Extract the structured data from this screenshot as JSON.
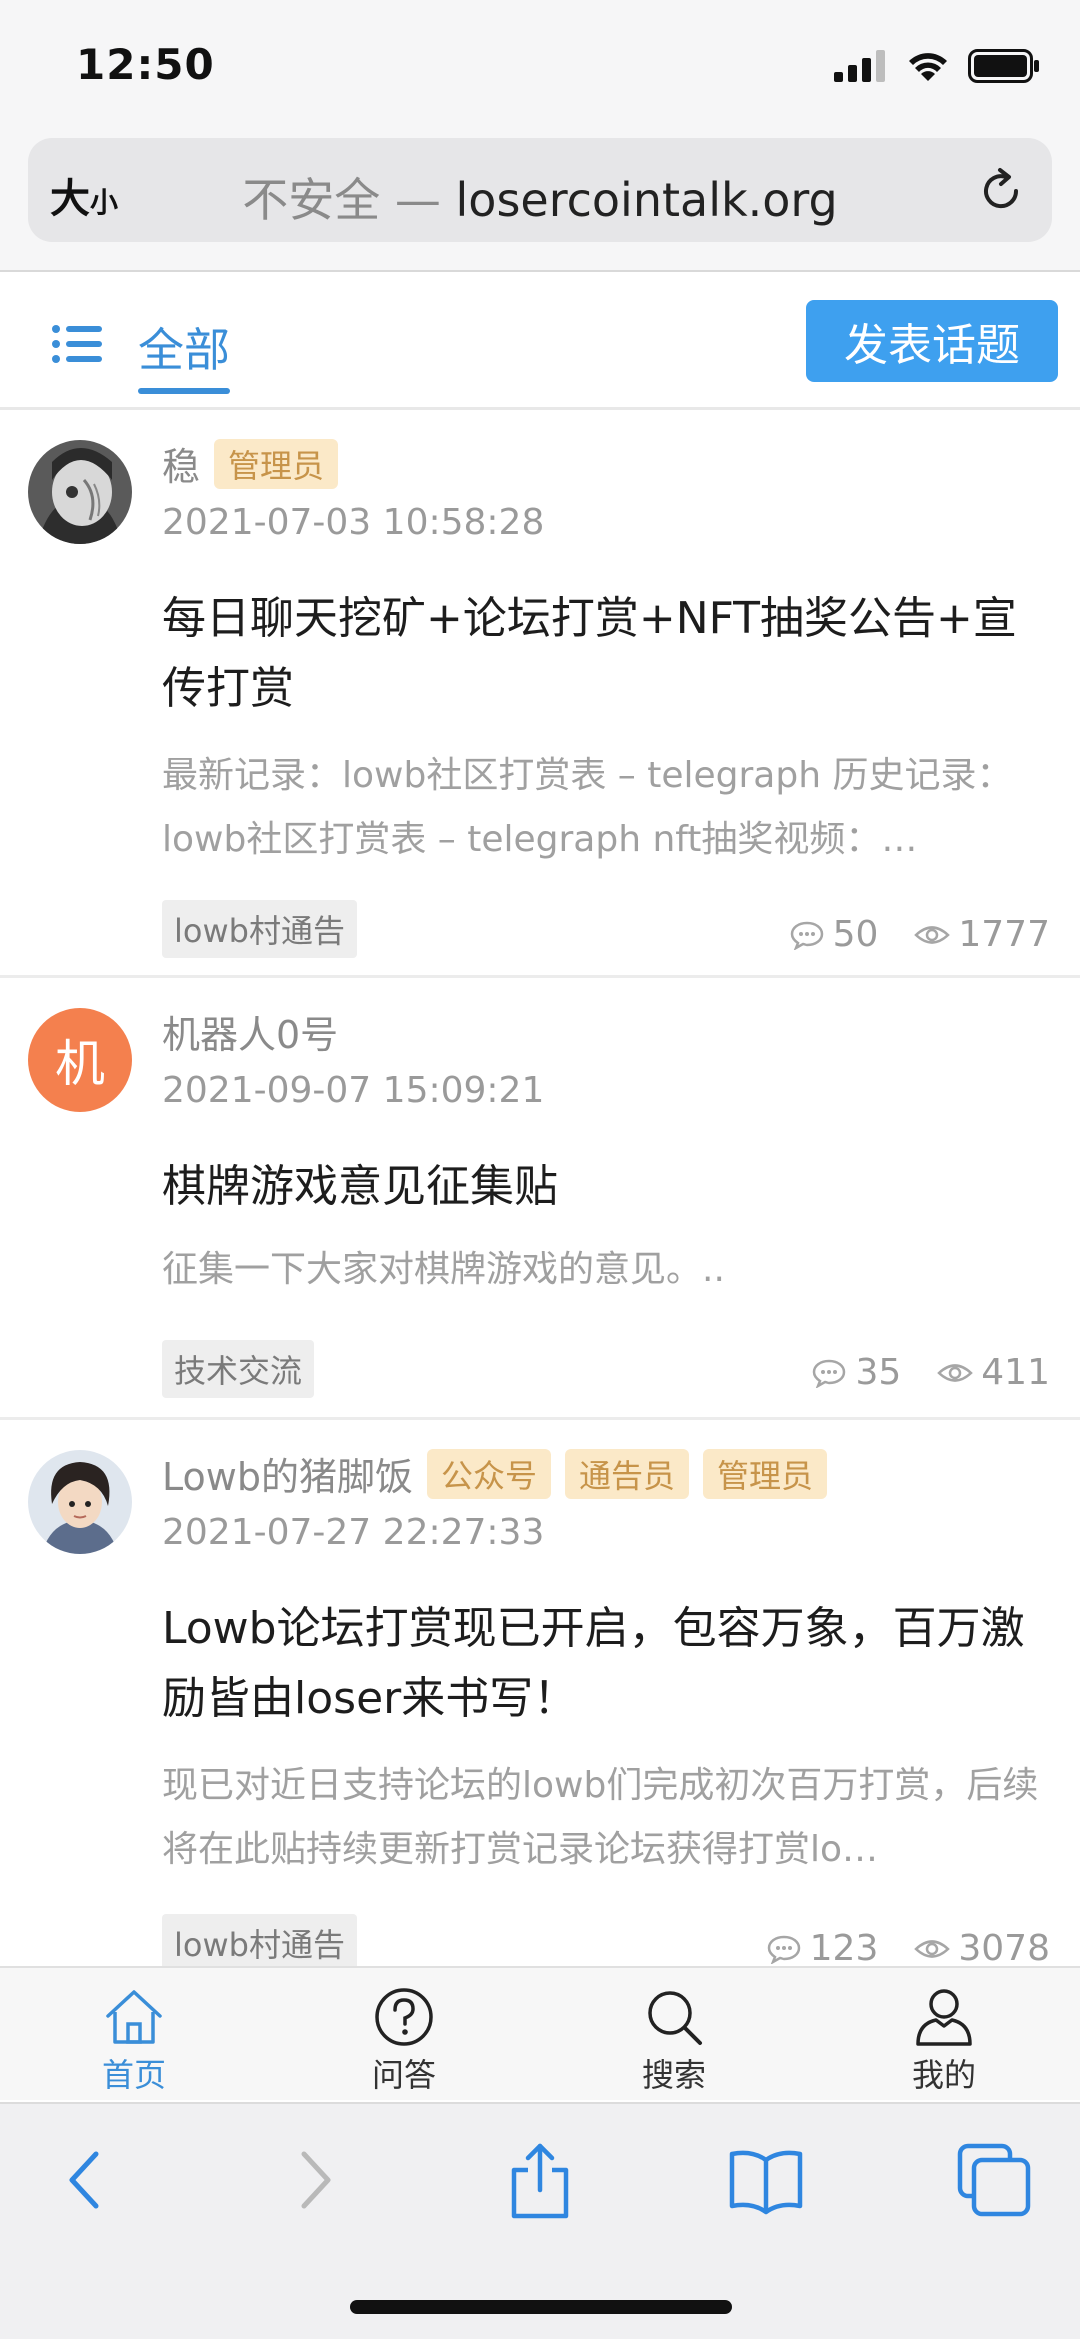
{
  "status_bar": {
    "time": "12:50"
  },
  "browser": {
    "size_label": "大",
    "size_label_small": "小",
    "insecure_label": "不安全",
    "separator": " — ",
    "url": "losercointalk.org"
  },
  "tabs": {
    "active": "全部",
    "post_button": "发表话题"
  },
  "posts": [
    {
      "author": "稳",
      "badges": [
        "管理员"
      ],
      "date": "2021-07-03 10:58:28",
      "title": "每日聊天挖矿+论坛打赏+NFT抽奖公告+宣传打赏",
      "excerpt": "最新记录：lowb社区打赏表 – telegraph 历史记录：lowb社区打赏表 – telegraph nft抽奖视频：…",
      "tag": "lowb村通告",
      "comments": "50",
      "views": "1777"
    },
    {
      "author": "机器人0号",
      "avatar_letter": "机",
      "badges": [],
      "date": "2021-09-07 15:09:21",
      "title": "棋牌游戏意见征集贴",
      "excerpt": "征集一下大家对棋牌游戏的意见。..",
      "tag": "技术交流",
      "comments": "35",
      "views": "411"
    },
    {
      "author": "Lowb的猪脚饭",
      "badges": [
        "公众号",
        "通告员",
        "管理员"
      ],
      "date": "2021-07-27 22:27:33",
      "title": "Lowb论坛打赏现已开启，包容万象，百万激励皆由loser来书写！",
      "excerpt": "现已对近日支持论坛的lowb们完成初次百万打赏，后续将在此贴持续更新打赏记录论坛获得打赏lo…",
      "tag": "lowb村通告",
      "comments": "123",
      "views": "3078"
    }
  ],
  "bottom_nav": [
    {
      "label": "首页",
      "icon": "home-icon",
      "active": true
    },
    {
      "label": "问答",
      "icon": "question-icon",
      "active": false
    },
    {
      "label": "搜索",
      "icon": "search-icon",
      "active": false
    },
    {
      "label": "我的",
      "icon": "user-icon",
      "active": false
    }
  ],
  "colors": {
    "accent": "#3a8ed8",
    "button": "#3ea0ef",
    "badge_bg": "#fbe9c8",
    "badge_text": "#c7944a",
    "avatar_orange": "#f4804e"
  }
}
